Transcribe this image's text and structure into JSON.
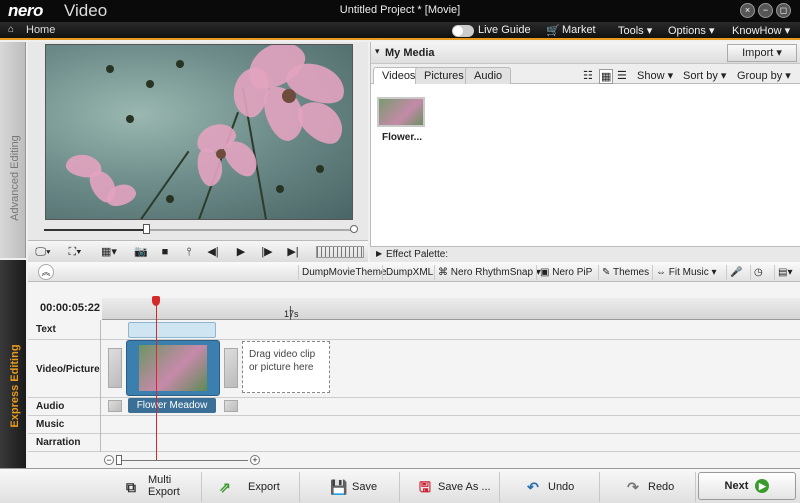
{
  "app": {
    "logo": "nero",
    "name": "Video",
    "window_title": "Untitled Project * [Movie]",
    "window_buttons": [
      "×",
      "−",
      "◻",
      "✕"
    ]
  },
  "nav": {
    "home": "Home",
    "live_guide": "Live Guide",
    "market": "Market",
    "tools": "Tools ▾",
    "options": "Options ▾",
    "knowhow": "KnowHow ▾"
  },
  "side_tabs": {
    "advanced": "Advanced Editing",
    "express": "Express Editing"
  },
  "preview": {
    "progress": 0.33
  },
  "media": {
    "title": "My Media",
    "import": "Import ▾",
    "tabs": [
      "Videos",
      "Pictures",
      "Audio"
    ],
    "show": "Show ▾",
    "sort_by": "Sort by ▾",
    "group_by": "Group by ▾",
    "items": [
      {
        "label": "Flower..."
      }
    ]
  },
  "effect_palette": "Effect Palette:",
  "toolbar": {
    "dump_movie_theme": "DumpMovieTheme",
    "dump_xml": "DumpXML",
    "rhythm_snap": "Nero RhythmSnap ▾",
    "pip": "Nero PiP",
    "themes": "Themes",
    "fit_music": "Fit Music ▾"
  },
  "timeline": {
    "timecode": "00:00:05:22",
    "ruler_label": "17s",
    "tracks": [
      "Text",
      "Video/Picture",
      "Audio",
      "Music",
      "Narration"
    ],
    "clip_name": "Flower Meadow",
    "drop_hint": "Drag video clip or picture here"
  },
  "bottom": {
    "multi_export": "Multi Export",
    "export": "Export",
    "save": "Save",
    "save_as": "Save As ...",
    "undo": "Undo",
    "redo": "Redo",
    "next": "Next"
  },
  "colors": {
    "accent": "#e89a1e",
    "clip_blue": "#3b7fae",
    "playhead": "#d42a2a"
  }
}
